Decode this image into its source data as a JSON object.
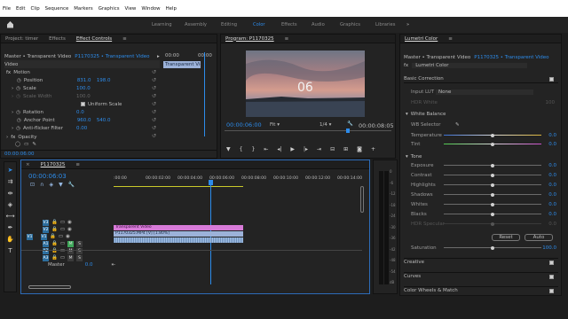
{
  "menu": [
    "File",
    "Edit",
    "Clip",
    "Sequence",
    "Markers",
    "Graphics",
    "View",
    "Window",
    "Help"
  ],
  "workspaces": [
    "Learning",
    "Assembly",
    "Editing",
    "Color",
    "Effects",
    "Audio",
    "Graphics",
    "Libraries"
  ],
  "workspace_active": "Color",
  "overflow": "»",
  "left_tabs": [
    "Project: timer",
    "Effects",
    "Effect Controls",
    "≡"
  ],
  "effect_controls": {
    "clip_path": "Master • Transparent Video",
    "clip_path2": "P1170325 • Transparent Video",
    "video_label": "Video",
    "mini_tc": "00:00",
    "mini_tc2": "00:00",
    "clip_bar": "Transparent Video",
    "motion": "Motion",
    "position_label": "Position",
    "position_x": "831.0",
    "position_y": "198.0",
    "scale_label": "Scale",
    "scale_val": "100.0",
    "scale_width_label": "Scale Width",
    "scale_width_val": "100.0",
    "uniform_label": "Uniform Scale",
    "rotation_label": "Rotation",
    "rotation_val": "0.0",
    "anchor_label": "Anchor Point",
    "anchor_x": "960.0",
    "anchor_y": "540.0",
    "antiflicker_label": "Anti-flicker Filter",
    "antiflicker_val": "0.00",
    "opacity_label": "Opacity",
    "timecode": "00:00:06:00"
  },
  "program": {
    "title": "Program: P1170325",
    "overlay_number": "06",
    "timecode": "00:00:06:00",
    "fit": "Fit",
    "fraction": "1/4",
    "duration": "00:00:08:05"
  },
  "lumetri": {
    "tab": "Lumetri Color",
    "path": "Master • Transparent Video",
    "path2": "P1170325 • Transparent Video",
    "fx_label": "fx",
    "effect_name": "Lumetri Color",
    "basic": "Basic Correction",
    "input_lut_label": "Input LUT",
    "input_lut_val": "None",
    "hdr_white_label": "HDR White",
    "hdr_white_val": "100",
    "white_balance": "White Balance",
    "wb_selector": "WB Selector",
    "temperature_label": "Temperature",
    "temperature_val": "0.0",
    "tint_label": "Tint",
    "tint_val": "0.0",
    "tone": "Tone",
    "tone_rows": [
      {
        "label": "Exposure",
        "val": "0.0"
      },
      {
        "label": "Contrast",
        "val": "0.0"
      },
      {
        "label": "Highlights",
        "val": "0.0"
      },
      {
        "label": "Shadows",
        "val": "0.0"
      },
      {
        "label": "Whites",
        "val": "0.0"
      },
      {
        "label": "Blacks",
        "val": "0.0"
      },
      {
        "label": "HDR Specular",
        "val": "0.0"
      }
    ],
    "reset": "Reset",
    "auto": "Auto",
    "saturation_label": "Saturation",
    "saturation_val": "100.0",
    "sections": [
      "Creative",
      "Curves",
      "Color Wheels & Match"
    ]
  },
  "timeline": {
    "title": "P1170325",
    "timecode": "00:00:06:03",
    "ruler": [
      ":00:00",
      "00:00:02:00",
      "00:00:04:00",
      "00:00:06:00",
      "00:00:08:00",
      "00:00:10:00",
      "00:00:12:00",
      "00:00:14:00"
    ],
    "tracks": {
      "v3": "V3",
      "v2": "V2",
      "v1": "V1",
      "a1": "A1",
      "a2": "A2",
      "a3": "A3",
      "src_v": "V1",
      "src_a": "A1",
      "master": "Master",
      "master_val": "0.0",
      "m": "M",
      "s": "S"
    },
    "clip_top": "Transparent Video",
    "clip_mid": "P1170325.MP4 [V] [1.80%]",
    "meter_labels": [
      "0",
      "-6",
      "-12",
      "-18",
      "-24",
      "-30",
      "-36",
      "-42",
      "-48",
      "-54",
      "dB"
    ]
  }
}
